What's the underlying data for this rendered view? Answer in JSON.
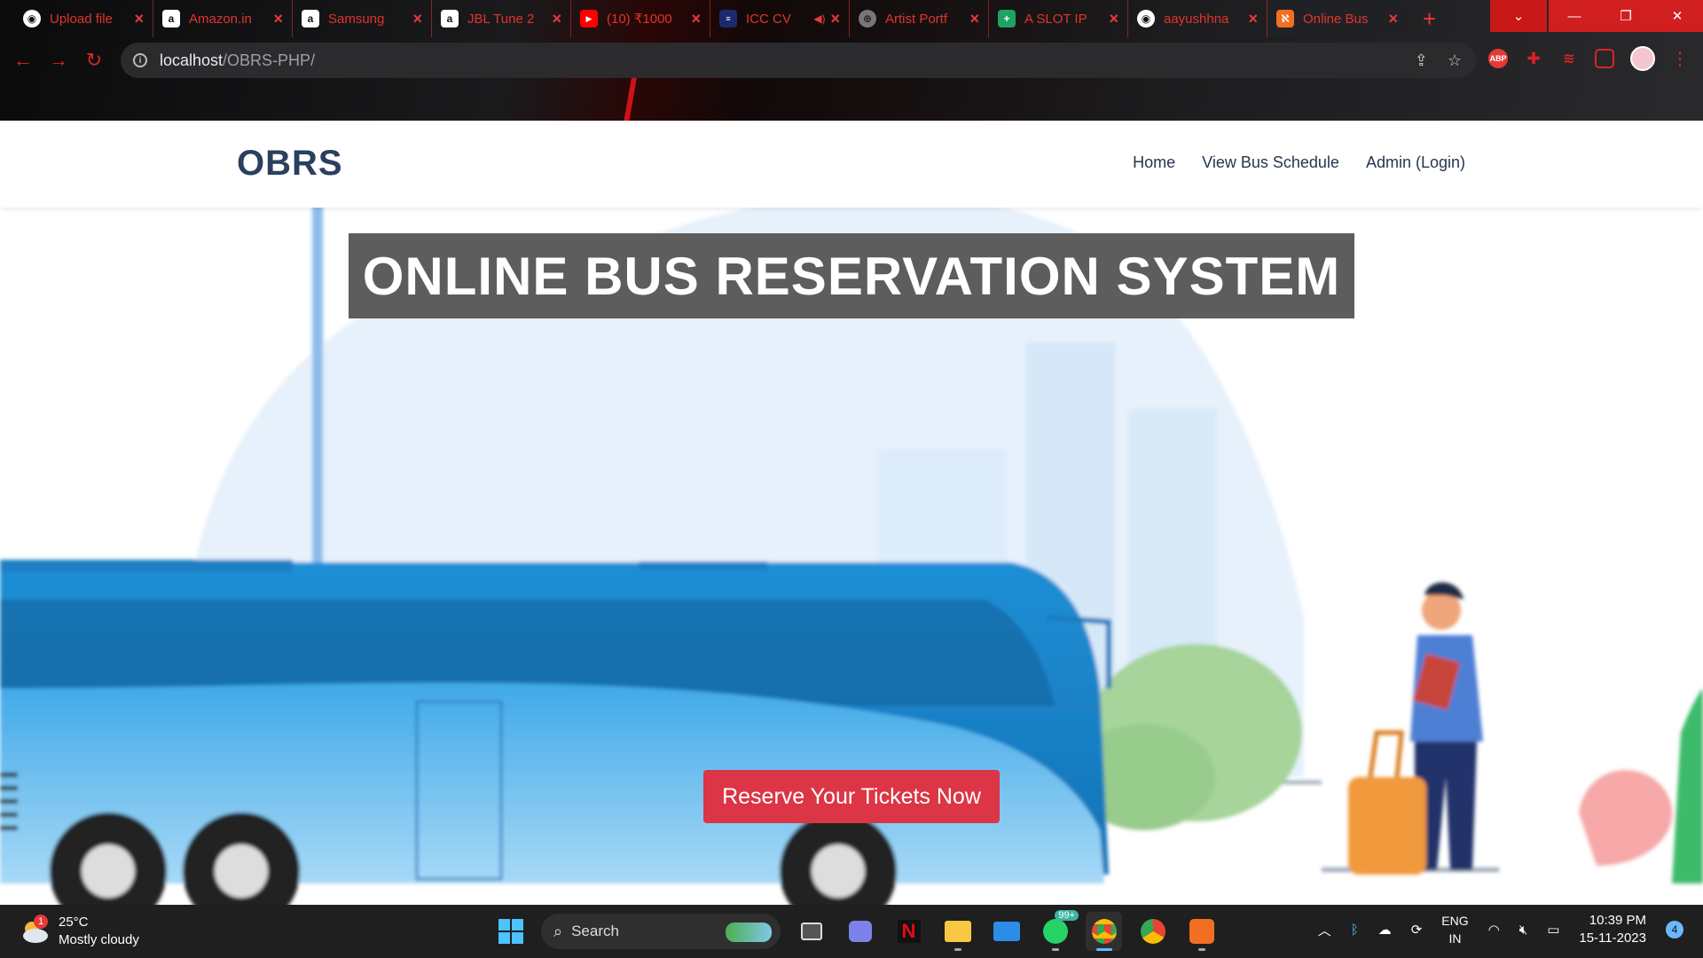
{
  "browser": {
    "tabs": [
      {
        "title": "Upload file",
        "icon": "github-icon"
      },
      {
        "title": "Amazon.in",
        "icon": "amazon-icon"
      },
      {
        "title": "Samsung",
        "icon": "amazon-icon"
      },
      {
        "title": "JBL Tune 2",
        "icon": "amazon-icon"
      },
      {
        "title": "(10) ₹1000",
        "icon": "youtube-icon"
      },
      {
        "title": "ICC CV",
        "icon": "news-icon"
      },
      {
        "title": "Artist Portf",
        "icon": "globe-icon"
      },
      {
        "title": "A SLOT IP",
        "icon": "sheets-icon"
      },
      {
        "title": "aayushhna",
        "icon": "github-icon"
      },
      {
        "title": "Online Bus",
        "icon": "xampp-icon"
      }
    ],
    "active_tab_index": 9,
    "url_host": "localhost",
    "url_path": "/OBRS-PHP/",
    "accent_color": "#e2342d"
  },
  "site": {
    "brand": "OBRS",
    "nav": [
      "Home",
      "View Bus Schedule",
      "Admin (Login)"
    ],
    "hero_title": "ONLINE BUS RESERVATION SYSTEM",
    "cta_label": "Reserve Your Tickets Now",
    "cta_color": "#dc3545",
    "brand_color": "#2b3f5e"
  },
  "taskbar": {
    "weather_temp": "25°C",
    "weather_desc": "Mostly cloudy",
    "weather_badge": "1",
    "search_placeholder": "Search",
    "whatsapp_badge": "99+",
    "lang_line1": "ENG",
    "lang_line2": "IN",
    "time": "10:39 PM",
    "date": "15-11-2023",
    "notification_count": "4"
  }
}
